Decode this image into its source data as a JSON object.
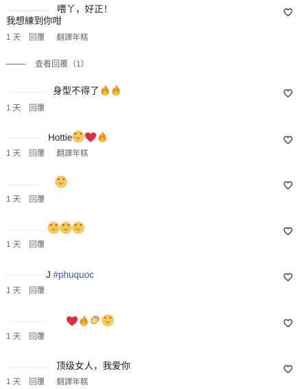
{
  "comments": [
    {
      "text_lines": [
        "喂丫，好正！",
        "我想練到你咁"
      ],
      "time": "1 天",
      "reply": "回覆",
      "translate": "翻譯年糕"
    },
    {
      "text": "身型不得了",
      "emojis": [
        "fire-icon",
        "fire-icon"
      ],
      "time": "1 天",
      "reply": "回覆"
    },
    {
      "text": "Hottie",
      "emojis": [
        "heart-eyes-icon",
        "red-heart-icon",
        "fire-icon"
      ],
      "time": "1 天",
      "reply": "回覆",
      "translate": "翻譯年糕"
    },
    {
      "text": "",
      "emojis": [
        "heart-eyes-icon"
      ],
      "time": "1 天",
      "reply": "回覆"
    },
    {
      "text": "",
      "emojis": [
        "heart-eyes-icon",
        "heart-eyes-icon",
        "heart-eyes-icon"
      ],
      "time": "1 天",
      "reply": "回覆"
    },
    {
      "text": "#phuquoc",
      "time": "1 天",
      "reply": "回覆"
    },
    {
      "text": "",
      "emojis": [
        "red-heart-icon",
        "fire-icon",
        "clapping-hands-icon",
        "heart-eyes-icon"
      ],
      "time": "1 天",
      "reply": "回覆"
    },
    {
      "text": "顶级女人，我爱你",
      "time": "1 天",
      "reply": "回覆",
      "translate": "翻譯年糕"
    }
  ],
  "view_replies": "查看回覆（1）",
  "colors": {
    "text": "#1c1e21",
    "meta": "#65676b",
    "hashtag": "#385898"
  }
}
